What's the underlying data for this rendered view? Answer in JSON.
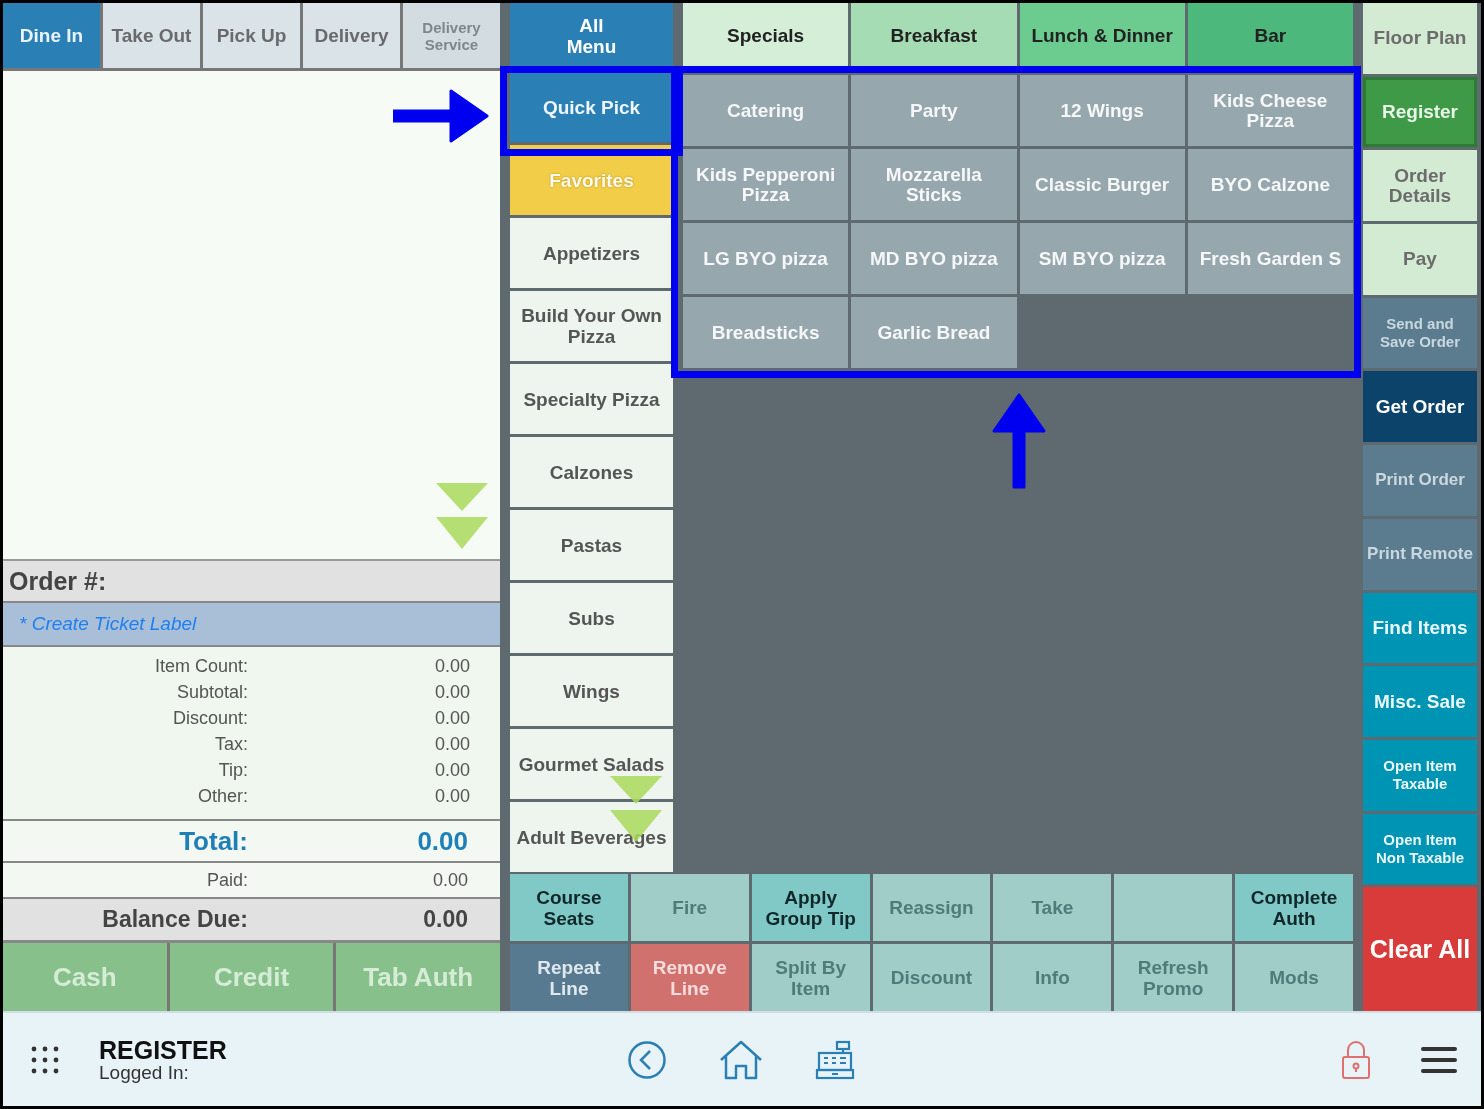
{
  "order_types": [
    {
      "label": "Dine In",
      "selected": true,
      "disabled": false
    },
    {
      "label": "Take Out",
      "selected": false,
      "disabled": false
    },
    {
      "label": "Pick Up",
      "selected": false,
      "disabled": false
    },
    {
      "label": "Delivery",
      "selected": false,
      "disabled": false
    },
    {
      "label": "Delivery Service",
      "selected": false,
      "disabled": true
    }
  ],
  "order_panel": {
    "order_label": "Order #:",
    "ticket_label": "* Create Ticket Label",
    "summary": [
      {
        "label": "Item Count:",
        "value": "0.00"
      },
      {
        "label": "Subtotal:",
        "value": "0.00"
      },
      {
        "label": "Discount:",
        "value": "0.00"
      },
      {
        "label": "Tax:",
        "value": "0.00"
      },
      {
        "label": "Tip:",
        "value": "0.00"
      },
      {
        "label": "Other:",
        "value": "0.00"
      }
    ],
    "total": {
      "label": "Total:",
      "value": "0.00"
    },
    "paid": {
      "label": "Paid:",
      "value": "0.00"
    },
    "balance_due": {
      "label": "Balance Due:",
      "value": "0.00"
    },
    "payments": [
      "Cash",
      "Credit",
      "Tab Auth"
    ]
  },
  "all_menu": "All Menu",
  "categories": [
    {
      "label": "Quick Pick",
      "selected": true,
      "kind": "normal"
    },
    {
      "label": "Favorites",
      "selected": false,
      "kind": "favorite"
    },
    {
      "label": "Appetizers",
      "selected": false,
      "kind": "normal"
    },
    {
      "label": "Build Your Own Pizza",
      "selected": false,
      "kind": "normal"
    },
    {
      "label": "Specialty Pizza",
      "selected": false,
      "kind": "normal"
    },
    {
      "label": "Calzones",
      "selected": false,
      "kind": "normal"
    },
    {
      "label": "Pastas",
      "selected": false,
      "kind": "normal"
    },
    {
      "label": "Subs",
      "selected": false,
      "kind": "normal"
    },
    {
      "label": "Wings",
      "selected": false,
      "kind": "normal"
    },
    {
      "label": "Gourmet Salads",
      "selected": false,
      "kind": "normal"
    },
    {
      "label": "Adult Beverages",
      "selected": false,
      "kind": "normal"
    }
  ],
  "menu_tabs": [
    {
      "label": "Specials",
      "color": "#d4eed8"
    },
    {
      "label": "Breakfast",
      "color": "#a6dcb4"
    },
    {
      "label": "Lunch & Dinner",
      "color": "#6ccb8e"
    },
    {
      "label": "Bar",
      "color": "#4db87b"
    }
  ],
  "items": [
    "Catering",
    "Party",
    "12 Wings",
    "Kids Cheese Pizza",
    "Kids Pepperoni Pizza",
    "Mozzarella Sticks",
    "Classic Burger",
    "BYO Calzone",
    "LG BYO pizza",
    "MD BYO pizza",
    "SM BYO pizza",
    "Fresh Garden S",
    "Breadsticks",
    "Garlic Bread"
  ],
  "actions": [
    {
      "label": "Course Seats",
      "kind": "teal",
      "disabled": false
    },
    {
      "label": "Fire",
      "kind": "teal",
      "disabled": true
    },
    {
      "label": "Apply Group Tip",
      "kind": "teal",
      "disabled": false
    },
    {
      "label": "Reassign",
      "kind": "teal",
      "disabled": true
    },
    {
      "label": "Take",
      "kind": "teal",
      "disabled": true
    },
    {
      "kind": "teal",
      "disabled": true
    },
    {
      "label": "Complete Auth",
      "kind": "teal",
      "disabled": false
    },
    {
      "label": "Repeat Line",
      "kind": "slate",
      "disabled": false
    },
    {
      "label": "Remove Line",
      "kind": "red",
      "disabled": false
    },
    {
      "label": "Split By Item",
      "kind": "teal",
      "disabled": true
    },
    {
      "label": "Discount",
      "kind": "teal",
      "disabled": true
    },
    {
      "label": "Info",
      "kind": "teal",
      "disabled": true
    },
    {
      "label": "Refresh Promo",
      "kind": "teal",
      "disabled": true
    },
    {
      "label": "Mods",
      "kind": "teal",
      "disabled": true
    }
  ],
  "side_buttons": [
    {
      "label": "Floor Plan",
      "kind": "light",
      "selected": false
    },
    {
      "label": "Register",
      "kind": "light",
      "selected": true
    },
    {
      "label": "Order Details",
      "kind": "light",
      "selected": false
    },
    {
      "label": "Pay",
      "kind": "light",
      "selected": false
    },
    {
      "label": "Send and Save Order",
      "kind": "slate",
      "selected": false
    },
    {
      "label": "Get Order",
      "kind": "navy",
      "selected": false
    },
    {
      "label": "Print Order",
      "kind": "slate",
      "selected": false
    },
    {
      "label": "Print Remote",
      "kind": "slate",
      "selected": false
    },
    {
      "label": "Find Items",
      "kind": "cyan",
      "selected": false
    },
    {
      "label": "Misc. Sale",
      "kind": "cyan",
      "selected": false
    },
    {
      "label": "Open Item Taxable",
      "kind": "cyan",
      "selected": false
    },
    {
      "label": "Open Item Non Taxable",
      "kind": "cyan",
      "selected": false
    },
    {
      "label": "Clear All",
      "kind": "red",
      "selected": false
    }
  ],
  "footer": {
    "title": "REGISTER",
    "subtitle": "Logged In:"
  }
}
